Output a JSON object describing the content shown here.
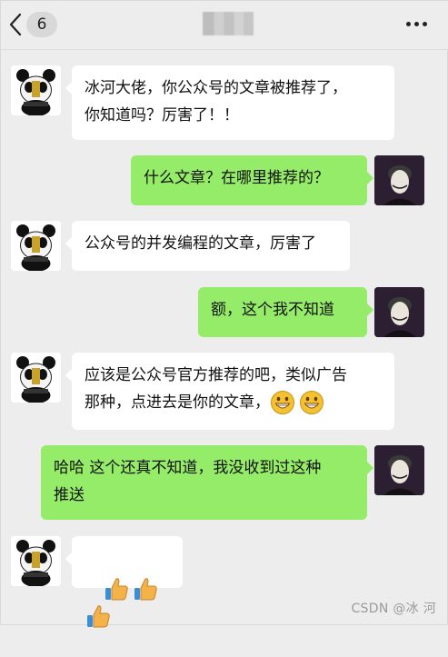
{
  "header": {
    "unread_count": "6",
    "contact_name_obscured": ""
  },
  "messages": [
    {
      "side": "left",
      "text": "冰河大佬，你公众号的文章被推荐了，\n你知道吗？厉害了！！"
    },
    {
      "side": "right",
      "text": "什么文章？在哪里推荐的？"
    },
    {
      "side": "left",
      "text": "公众号的并发编程的文章，厉害了"
    },
    {
      "side": "right",
      "text": "额，这个我不知道"
    },
    {
      "side": "left",
      "text": "应该是公众号官方推荐的吧，类似广告\n那种，点进去是你的文章，",
      "emojis": [
        "grinning-face",
        "grinning-face"
      ]
    },
    {
      "side": "right",
      "text": "哈哈 这个还真不知道，我没收到过这种\n推送"
    },
    {
      "side": "left",
      "text": "",
      "emojis": [
        "thumbs-up",
        "thumbs-up",
        "thumbs-up"
      ]
    }
  ],
  "watermark": "CSDN @冰 河",
  "colors": {
    "background": "#ededed",
    "left_bubble": "#ffffff",
    "right_bubble": "#95ec69"
  }
}
